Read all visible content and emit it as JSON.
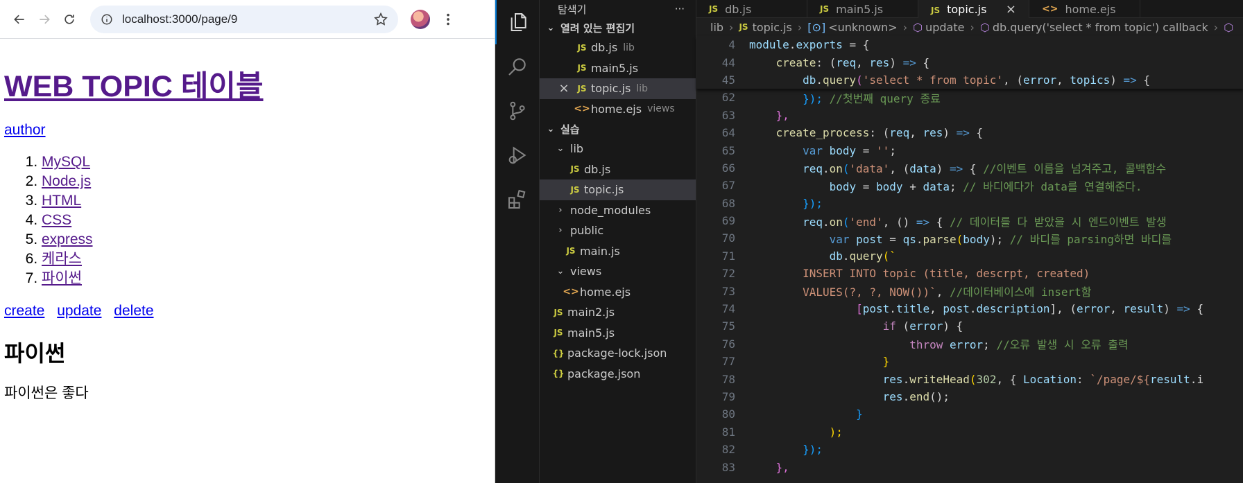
{
  "browser": {
    "url": "localhost:3000/page/9",
    "page": {
      "heading": "WEB TOPIC 테이블",
      "author_link": "author",
      "topics": [
        "MySQL",
        "Node.js",
        "HTML",
        "CSS",
        "express",
        "케라스",
        "파이썬"
      ],
      "actions": [
        "create",
        "update",
        "delete"
      ],
      "topic_title": "파이썬",
      "topic_description": "파이썬은 좋다"
    }
  },
  "vscode": {
    "explorer_title": "탐색기",
    "open_editors_title": "열려 있는 편집기",
    "open_editors": [
      {
        "name": "db.js",
        "desc": "lib"
      },
      {
        "name": "main5.js",
        "desc": ""
      },
      {
        "name": "topic.js",
        "desc": "lib"
      },
      {
        "name": "home.ejs",
        "desc": "views"
      }
    ],
    "workspace_title": "실습",
    "tree": {
      "lib": "lib",
      "lib_db": "db.js",
      "lib_topic": "topic.js",
      "node_modules": "node_modules",
      "public": "public",
      "public_main": "main.js",
      "views": "views",
      "views_home": "home.ejs",
      "main2": "main2.js",
      "main5": "main5.js",
      "package_lock": "package-lock.json",
      "package": "package.json"
    },
    "tabs": [
      "db.js",
      "main5.js",
      "topic.js",
      "home.ejs"
    ],
    "breadcrumb": [
      "lib",
      "topic.js",
      "<unknown>",
      "update",
      "db.query('select * from topic') callback"
    ],
    "line_numbers": [
      4,
      44,
      45,
      62,
      63,
      64,
      65,
      66,
      67,
      68,
      69,
      70,
      71,
      72,
      73,
      74,
      75,
      76,
      77,
      78,
      79,
      80,
      81,
      82,
      83
    ],
    "code": {
      "l4": [
        "module",
        ".",
        "exports",
        " = {"
      ],
      "l44": [
        "create",
        ": (",
        "req",
        ", ",
        "res",
        ") ",
        "=>",
        " {"
      ],
      "l45": [
        "db",
        ".",
        "query",
        "(",
        "'select * from topic'",
        ", (",
        "error",
        ", ",
        "topics",
        ") ",
        "=>",
        " {"
      ],
      "l62": [
        "}); ",
        "//첫번째 query 종료"
      ],
      "l63": [
        "},"
      ],
      "l64": [
        "create_process",
        ": (",
        "req",
        ", ",
        "res",
        ") ",
        "=>",
        " {"
      ],
      "l65": [
        "var",
        " ",
        "body",
        " = ",
        "''",
        ";"
      ],
      "l66": [
        "req",
        ".",
        "on",
        "(",
        "'data'",
        ", (",
        "data",
        ") ",
        "=>",
        " { ",
        "//이벤트 이름을 넘겨주고, 콜백함수"
      ],
      "l67": [
        "body",
        " = ",
        "body",
        " + ",
        "data",
        "; ",
        "// 바디에다가 data를 연결해준다."
      ],
      "l68": [
        "});"
      ],
      "l69": [
        "req",
        ".",
        "on",
        "(",
        "'end'",
        ", () ",
        "=>",
        " { ",
        "// 데이터를 다 받았을 시 엔드이벤트 발생"
      ],
      "l70": [
        "var",
        " ",
        "post",
        " = ",
        "qs",
        ".",
        "parse",
        "(",
        "body",
        "); ",
        "// 바디를 parsing하면 바디를"
      ],
      "l71": [
        "db",
        ".",
        "query",
        "(`"
      ],
      "l72": [
        "INSERT INTO topic (title, descrpt, created)"
      ],
      "l73": [
        "VALUES(?, ?, NOW())`",
        ", ",
        "//데이터베이스에 insert함"
      ],
      "l74": [
        "[",
        "post",
        ".",
        "title",
        ", ",
        "post",
        ".",
        "description",
        "], (",
        "error",
        ", ",
        "result",
        ") ",
        "=>",
        " {"
      ],
      "l75": [
        "if",
        " (",
        "error",
        ") {"
      ],
      "l76": [
        "throw",
        " ",
        "error",
        "; ",
        "//오류 발생 시 오류 출력"
      ],
      "l77": [
        "}"
      ],
      "l78": [
        "res",
        ".",
        "writeHead",
        "(",
        "302",
        ", { ",
        "Location",
        ": ",
        "`/page/${",
        "result",
        ".i"
      ],
      "l79": [
        "res",
        ".",
        "end",
        "();"
      ],
      "l80": [
        "}"
      ],
      "l81": [
        ");"
      ],
      "l82": [
        "});"
      ],
      "l83": [
        "},"
      ]
    }
  }
}
